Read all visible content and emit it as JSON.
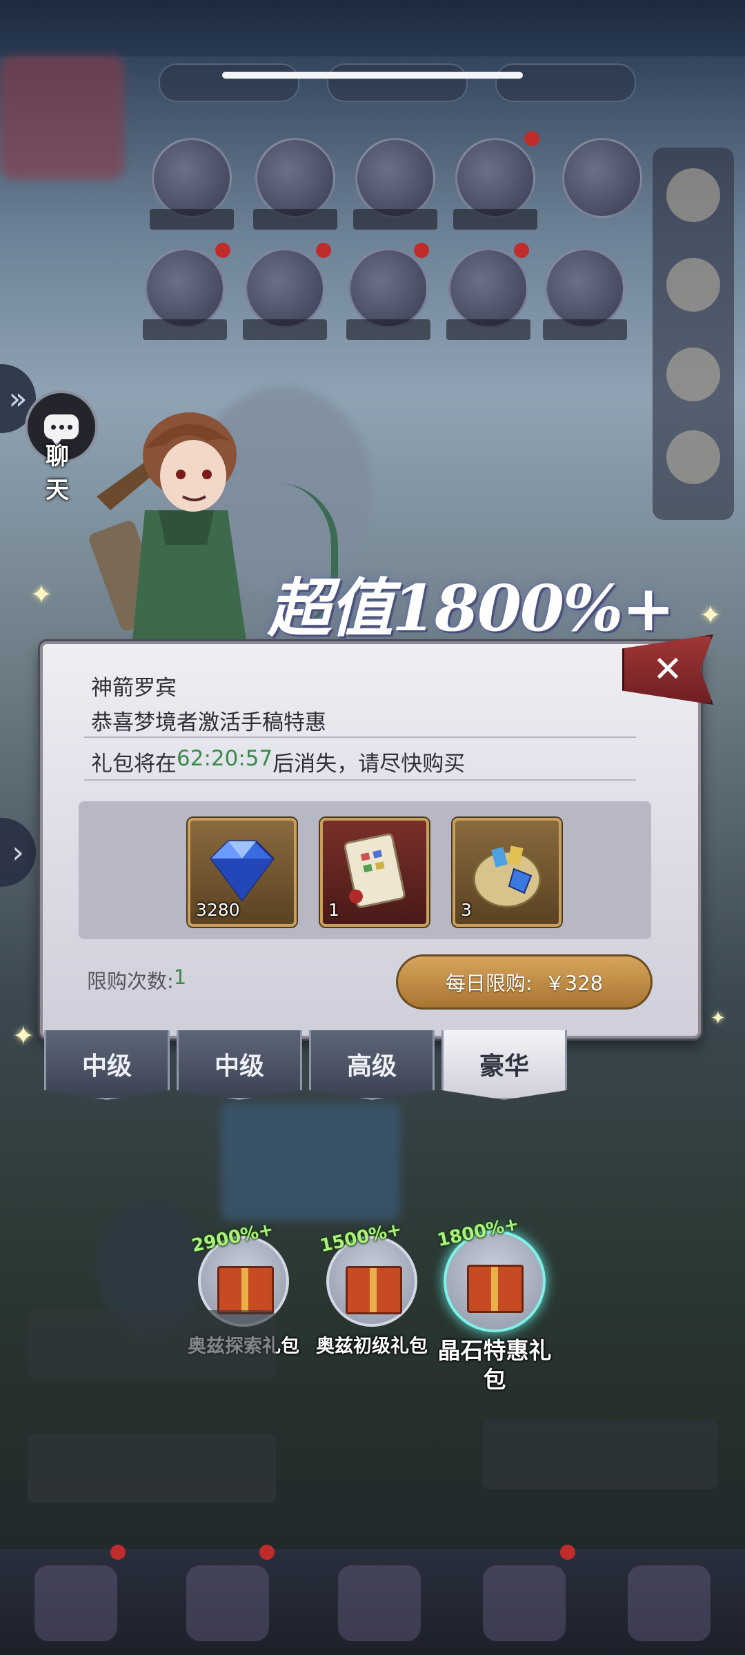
{
  "chat": {
    "label": "聊 天"
  },
  "banner": {
    "text": "超值1800%+"
  },
  "dialog": {
    "title": "神箭罗宾",
    "subtitle": "恭喜梦境者激活手稿特惠",
    "timer_prefix": "礼包将在",
    "timer_value": "62:20:57",
    "timer_suffix": "后消失，请尽快购买",
    "items": [
      {
        "icon": "diamond-icon",
        "count": "3280"
      },
      {
        "icon": "manuscript-scroll-icon",
        "count": "1"
      },
      {
        "icon": "treasure-bag-icon",
        "count": "3"
      }
    ],
    "limit_label": "限购次数:",
    "limit_value": "1",
    "buy_label": "每日限购:",
    "buy_price": "￥328",
    "close_icon": "close-icon"
  },
  "tabs": [
    {
      "label": "中级",
      "active": false
    },
    {
      "label": "中级",
      "active": false
    },
    {
      "label": "高级",
      "active": false
    },
    {
      "label": "豪华",
      "active": true
    }
  ],
  "packs": [
    {
      "badge": "2900%+",
      "label": "奥兹探索礼包",
      "active": false
    },
    {
      "badge": "1500%+",
      "label": "奥兹初级礼包",
      "active": false
    },
    {
      "badge": "1800%+",
      "label": "晶石特惠礼包",
      "active": true
    }
  ],
  "colors": {
    "accent_gold": "#c9a05a",
    "timer_green": "#3c8a4a",
    "close_red": "#a13636",
    "pack_highlight": "#7ef2e8"
  }
}
